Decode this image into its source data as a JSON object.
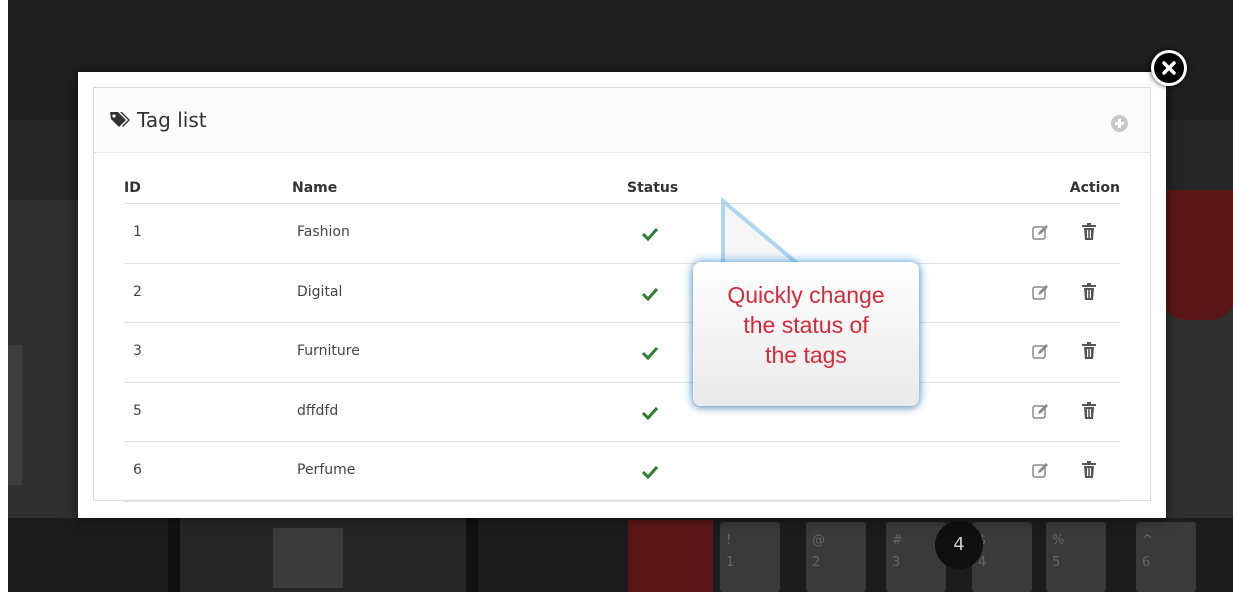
{
  "modal": {
    "title": "Tag list",
    "columns": {
      "id": "ID",
      "name": "Name",
      "status": "Status",
      "action": "Action"
    },
    "rows": [
      {
        "id": "1",
        "name": "Fashion",
        "status": "active"
      },
      {
        "id": "2",
        "name": "Digital",
        "status": "active"
      },
      {
        "id": "3",
        "name": "Furniture",
        "status": "active"
      },
      {
        "id": "5",
        "name": "dffdfd",
        "status": "active"
      },
      {
        "id": "6",
        "name": "Perfume",
        "status": "active"
      }
    ]
  },
  "callout": {
    "line1": "Quickly change",
    "line2": "the status of",
    "line3": "the tags"
  },
  "background": {
    "keys": [
      {
        "top": "!",
        "bottom": "1"
      },
      {
        "top": "@",
        "bottom": "2"
      },
      {
        "top": "#",
        "bottom": "3"
      },
      {
        "top": "$",
        "bottom": "4"
      },
      {
        "top": "%",
        "bottom": "5"
      },
      {
        "top": "^",
        "bottom": "6"
      }
    ],
    "badge": "4"
  },
  "colors": {
    "check": "#2e7d32",
    "callout_text": "#d42a3a",
    "callout_glow": "#3c96dc"
  },
  "icons": {
    "title": "tags-icon",
    "add": "plus-circle-icon",
    "status": "check-icon",
    "edit": "edit-icon",
    "delete": "trash-icon",
    "close": "close-icon"
  }
}
